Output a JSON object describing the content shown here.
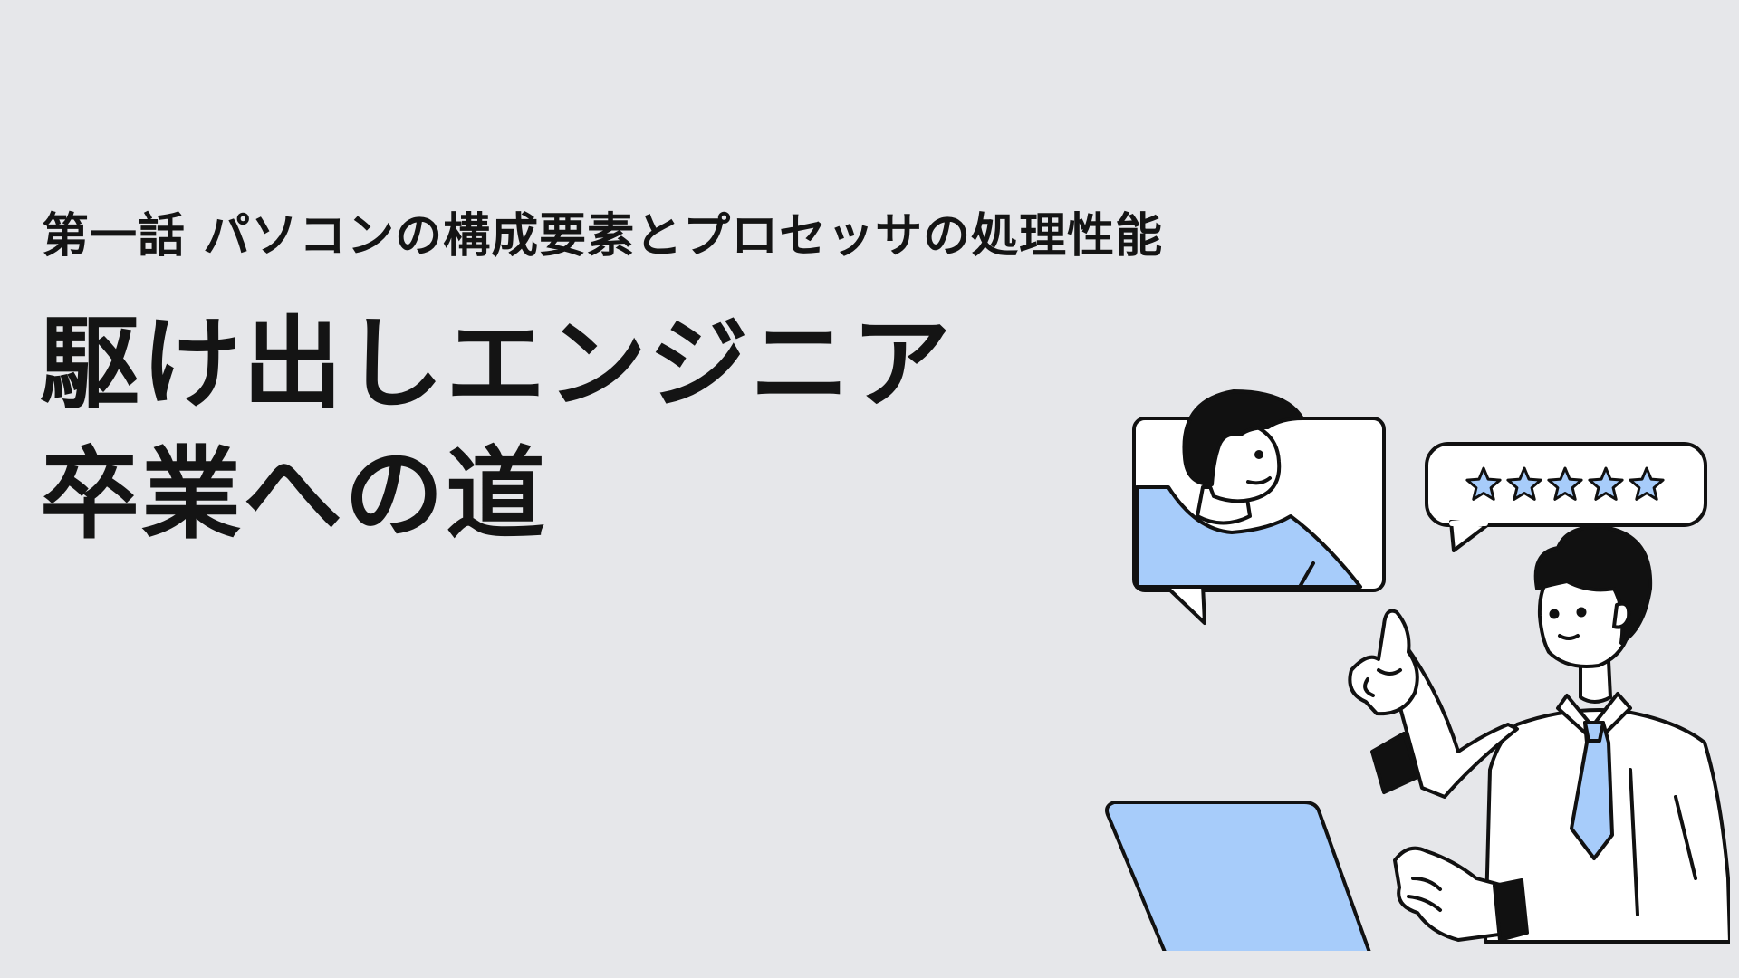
{
  "slide": {
    "subtitle": "第一話 パソコンの構成要素とプロセッサの処理性能",
    "title_lines": [
      "駆け出しエンジニア",
      "卒業への道"
    ]
  },
  "colors": {
    "background": "#e6e7ea",
    "text": "#141414",
    "accent_blue": "#a7ccfa",
    "outline": "#111111",
    "white": "#ffffff"
  },
  "illustration": {
    "rating_stars": 5,
    "icons": [
      "video-call-bubble",
      "rating-bubble",
      "pointing-businessman",
      "laptop"
    ]
  }
}
